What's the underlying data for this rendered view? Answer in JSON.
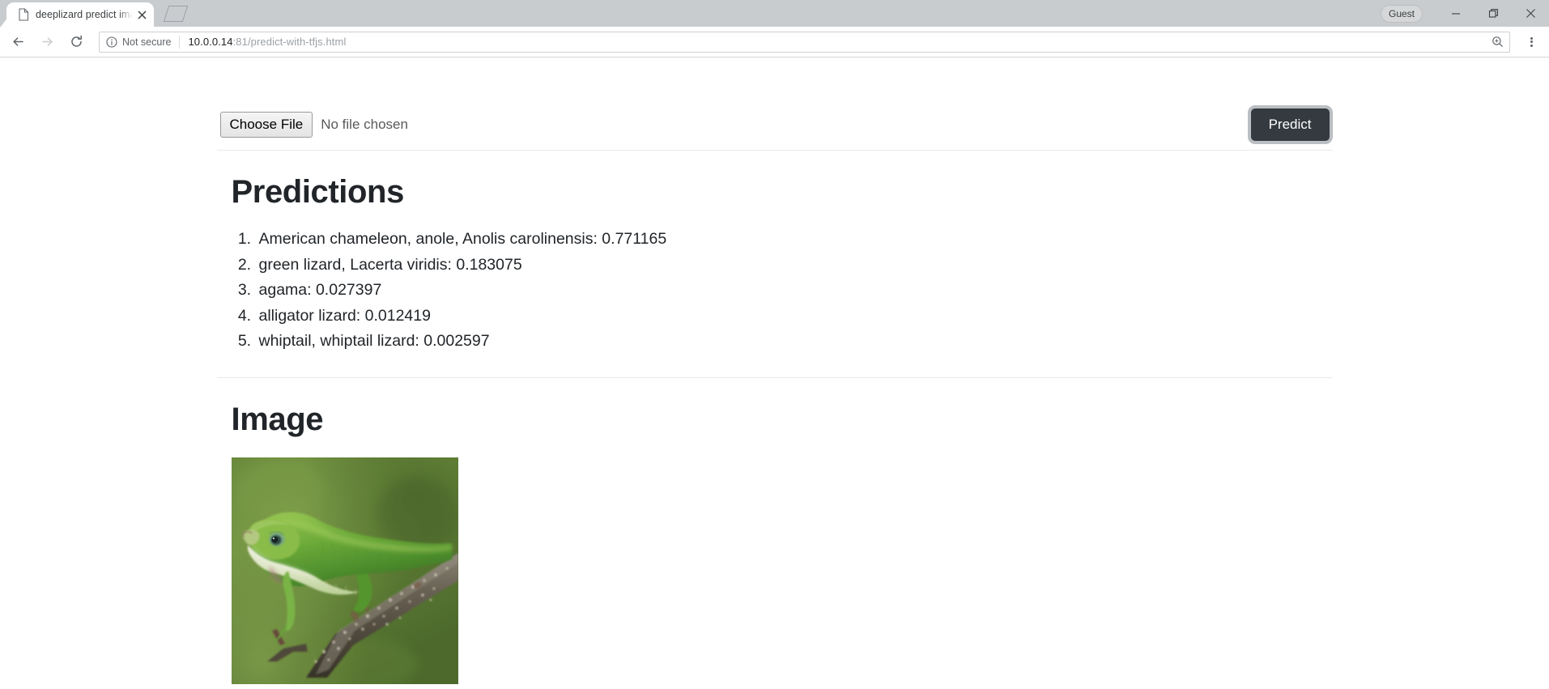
{
  "browser": {
    "tab": {
      "title": "deeplizard predict image",
      "favicon_icon": "document-icon",
      "close_icon": "close-icon"
    },
    "new_tab_icon": "new-tab-icon",
    "profile_label": "Guest",
    "window_controls": {
      "minimize_icon": "minimize-icon",
      "maximize_icon": "maximize-restore-icon",
      "close_icon": "window-close-icon"
    },
    "nav": {
      "back_icon": "back-arrow-icon",
      "forward_icon": "forward-arrow-icon",
      "reload_icon": "reload-icon"
    },
    "omnibox": {
      "security_icon": "info-circle-icon",
      "security_label": "Not secure",
      "url_host": "10.0.0.14",
      "url_rest": ":81/predict-with-tfjs.html",
      "zoom_icon": "zoom-magnifier-icon"
    },
    "menu_icon": "three-dot-menu-icon"
  },
  "page": {
    "file_picker": {
      "button_label": "Choose File",
      "status_text": "No file chosen"
    },
    "predict_button_label": "Predict",
    "predictions": {
      "heading": "Predictions",
      "items": [
        "American chameleon, anole, Anolis carolinensis: 0.771165",
        "green lizard, Lacerta viridis: 0.183075",
        "agama: 0.027397",
        "alligator lizard: 0.012419",
        "whiptail, whiptail lizard: 0.002597"
      ]
    },
    "image_section": {
      "heading": "Image",
      "image_alt": "green anole lizard perched on a branch"
    }
  },
  "colors": {
    "predict_button_bg": "#343a40",
    "predict_button_focus_ring": "#828a91",
    "heading_text": "#212529",
    "body_text": "#212529",
    "muted_text": "#5f6368",
    "divider": "#e8e9ea",
    "chrome_titlebar": "#c9ccce"
  }
}
